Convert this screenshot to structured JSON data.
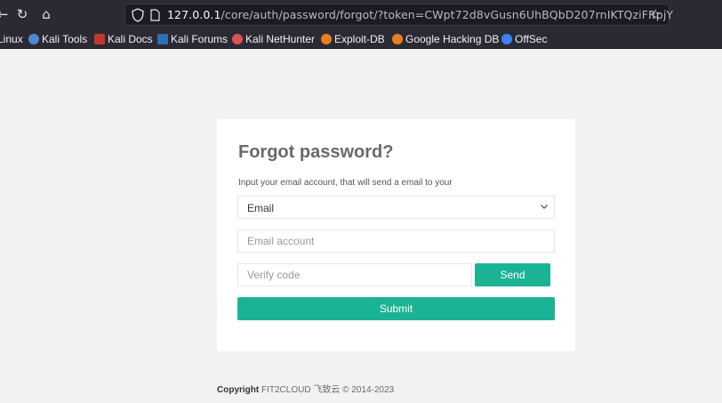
{
  "browser": {
    "url_prefix": "127.0.0.1",
    "url_path": "/core/auth/password/forgot/?token=CWpt72d8vGusn6UhBQbD207rnIKTQziFRpjY",
    "icons": [
      "back-arrow-icon",
      "reload-icon",
      "home-icon",
      "shield-icon",
      "page-icon",
      "star-icon"
    ],
    "bookmarks": [
      {
        "label": "Linux",
        "icon": "kali-icon",
        "color": "#2b2a33"
      },
      {
        "label": "Kali Tools",
        "icon": "kali-tools-icon",
        "color": "#4e8ad4"
      },
      {
        "label": "Kali Docs",
        "icon": "kali-docs-icon",
        "color": "#c0392b"
      },
      {
        "label": "Kali Forums",
        "icon": "kali-forums-icon",
        "color": "#2f6fb3"
      },
      {
        "label": "Kali NetHunter",
        "icon": "nethunter-icon",
        "color": "#d9534f"
      },
      {
        "label": "Exploit-DB",
        "icon": "exploit-db-icon",
        "color": "#e67e22"
      },
      {
        "label": "Google Hacking DB",
        "icon": "ghdb-icon",
        "color": "#e67e22"
      },
      {
        "label": "OffSec",
        "icon": "offsec-icon",
        "color": "#3b82f6"
      }
    ]
  },
  "form": {
    "title": "Forgot password?",
    "hint": "Input your email account, that will send a email to your",
    "select_value": "Email",
    "email_placeholder": "Email account",
    "code_placeholder": "Verify code",
    "send_label": "Send",
    "submit_label": "Submit"
  },
  "footer": {
    "copyright_label": "Copyright",
    "company": "FIT2CLOUD 飞致云 © 2014-2023"
  },
  "colors": {
    "accent": "#1ab394",
    "chrome": "#2b2a33"
  }
}
